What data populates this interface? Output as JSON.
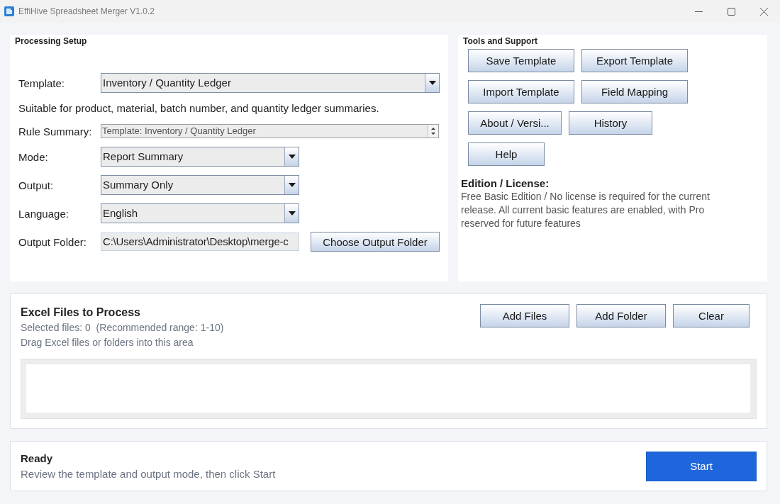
{
  "window": {
    "title": "EffiHive Spreadsheet Merger V1.0.2"
  },
  "processing_setup": {
    "title": "Processing Setup",
    "template": {
      "label": "Template:",
      "value": "Inventory / Quantity Ledger"
    },
    "description": "Suitable for product, material, batch number, and quantity ledger summaries.",
    "rule_summary": {
      "label": "Rule Summary:",
      "value": "Template: Inventory / Quantity Ledger"
    },
    "dropdowns": [
      {
        "label": "Mode:",
        "value": "Report Summary"
      },
      {
        "label": "Output:",
        "value": "Summary Only"
      },
      {
        "label": "Language:",
        "value": "English"
      }
    ],
    "output_folder": {
      "label": "Output Folder:",
      "value": "C:\\Users\\Administrator\\Desktop\\merge-c",
      "button": "Choose Output Folder"
    }
  },
  "tools_and_support": {
    "title": "Tools and Support",
    "buttons": [
      "Save Template",
      "Export Template",
      "Import Template",
      "Field Mapping",
      "About / Versi...",
      "History",
      "Help"
    ],
    "license": {
      "heading": "Edition / License:",
      "text": "Free Basic Edition / No license is required for the current release. All current basic features are enabled, with Pro reserved for future features"
    }
  },
  "excel_files": {
    "title": "Excel Files to Process",
    "selected": "Selected files: 0  (Recommended range: 1-10)",
    "hint": "Drag Excel files or folders into this area",
    "buttons": [
      "Add Files",
      "Add Folder",
      "Clear"
    ]
  },
  "status": {
    "title": "Ready",
    "message": "Review the template and output mode, then click Start",
    "button": "Start"
  }
}
